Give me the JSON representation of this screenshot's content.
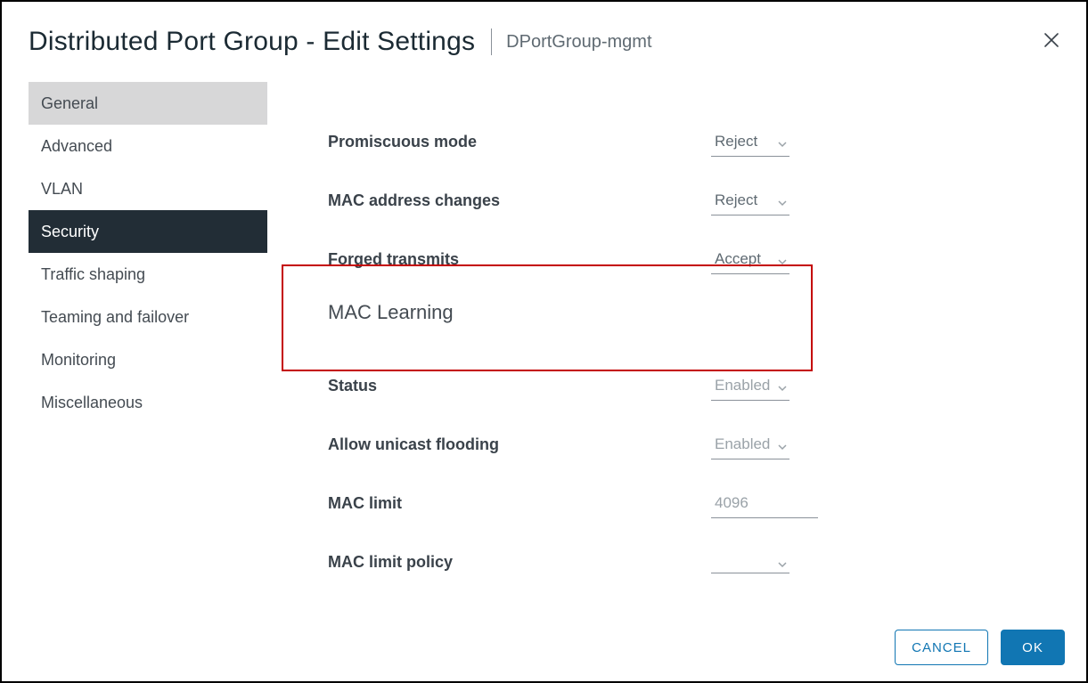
{
  "header": {
    "title": "Distributed Port Group - Edit Settings",
    "portgroup": "DPortGroup-mgmt"
  },
  "sidebar": {
    "items": [
      {
        "label": "General"
      },
      {
        "label": "Advanced"
      },
      {
        "label": "VLAN"
      },
      {
        "label": "Security"
      },
      {
        "label": "Traffic shaping"
      },
      {
        "label": "Teaming and failover"
      },
      {
        "label": "Monitoring"
      },
      {
        "label": "Miscellaneous"
      }
    ]
  },
  "security": {
    "promiscuous_label": "Promiscuous mode",
    "promiscuous_value": "Reject",
    "mac_changes_label": "MAC address changes",
    "mac_changes_value": "Reject",
    "forged_label": "Forged transmits",
    "forged_value": "Accept",
    "mac_learning_title": "MAC Learning",
    "status_label": "Status",
    "status_value": "Enabled",
    "flooding_label": "Allow unicast flooding",
    "flooding_value": "Enabled",
    "mac_limit_label": "MAC limit",
    "mac_limit_value": "4096",
    "mac_limit_policy_label": "MAC limit policy",
    "mac_limit_policy_value": ""
  },
  "footer": {
    "cancel": "CANCEL",
    "ok": "OK"
  }
}
